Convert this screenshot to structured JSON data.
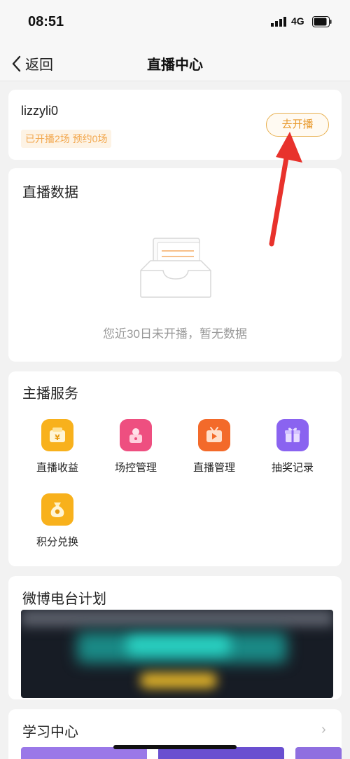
{
  "status_bar": {
    "time": "08:51",
    "network": "4G"
  },
  "nav": {
    "back_label": "返回",
    "title": "直播中心"
  },
  "user": {
    "name": "lizzyli0",
    "stats": "已开播2场 预约0场",
    "go_live_label": "去开播"
  },
  "live_data": {
    "title": "直播数据",
    "empty_text": "您近30日未开播，暂无数据"
  },
  "services": {
    "title": "主播服务",
    "items": [
      {
        "label": "直播收益",
        "icon": "coin-wallet-icon",
        "color": "#f8b11c"
      },
      {
        "label": "场控管理",
        "icon": "person-lock-icon",
        "color": "#ee4f80"
      },
      {
        "label": "直播管理",
        "icon": "tv-play-icon",
        "color": "#f36a2a"
      },
      {
        "label": "抽奖记录",
        "icon": "gift-icon",
        "color": "#8a63f0"
      },
      {
        "label": "积分兑换",
        "icon": "points-bag-icon",
        "color": "#f8b11c"
      }
    ]
  },
  "radio_plan": {
    "title": "微博电台计划"
  },
  "learning": {
    "title": "学习中心"
  },
  "colors": {
    "accent": "#e89a2e",
    "arrow": "#e8322c"
  }
}
